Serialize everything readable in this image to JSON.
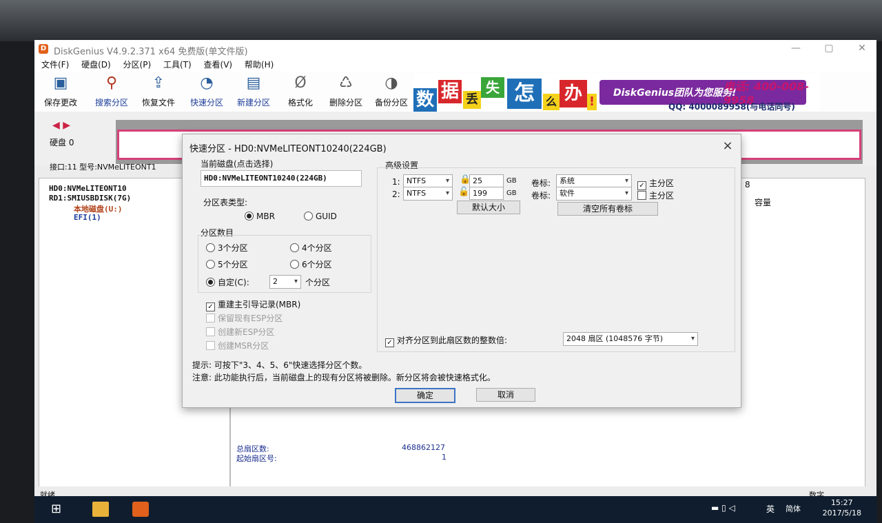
{
  "window": {
    "title": "DiskGenius V4.9.2.371 x64 免费版(单文件版)",
    "min_label": "—",
    "max_label": "▢",
    "close_label": "✕"
  },
  "menu": [
    "文件(F)",
    "硬盘(D)",
    "分区(P)",
    "工具(T)",
    "查看(V)",
    "帮助(H)"
  ],
  "toolbar": [
    "保存更改",
    "搜索分区",
    "恢复文件",
    "快速分区",
    "新建分区",
    "格式化",
    "删除分区",
    "备份分区"
  ],
  "banner": {
    "chars": [
      "数",
      "据",
      "丢",
      "失",
      "怎",
      "么",
      "办"
    ],
    "exclaim": "!",
    "slogan": "DiskGenius团队为您服务!",
    "phone": "电话: 400-008-9958",
    "qq": "QQ: 4000089958(与电话同号)"
  },
  "disk_nav_arrows": "◀ ▶",
  "disk_label": "硬盘 0",
  "disk_info": "接口:11  型号:NVMeLITEONT1",
  "tree": [
    "HD0:NVMeLITEONT10",
    "RD1:SMIUSBDISK(7G)",
    "本地磁盘(U:)",
    "EFI(1)"
  ],
  "right_header": "容量",
  "bg_right_partial": "8",
  "bg_labels": {
    "total_sectors": "总扇区数:",
    "total_sectors_value": "468862127",
    "start_sector": "起始扇区号:",
    "start_sector_value": "1"
  },
  "statusbar": {
    "left": "就绪",
    "right": "数字"
  },
  "taskbar": {
    "ime": "英",
    "ime2": "简体",
    "time": "15:27",
    "date": "2017/5/18"
  },
  "dialog": {
    "title": "快速分区 - HD0:NVMeLITEONT10240(224GB)",
    "close_label": "×",
    "current_disk_label": "当前磁盘(点击选择)",
    "current_disk_value": "HD0:NVMeLITEONT10240(224GB)",
    "table_type_label": "分区表类型:",
    "mbr": "MBR",
    "guid": "GUID",
    "count_label": "分区数目",
    "counts": [
      "3个分区",
      "4个分区",
      "5个分区",
      "6个分区"
    ],
    "custom_label": "自定(C):",
    "custom_value": "2",
    "custom_suffix": "个分区",
    "rebuild_mbr": "重建主引导记录(MBR)",
    "keep_esp": "保留现有ESP分区",
    "create_esp": "创建新ESP分区",
    "create_msr": "创建MSR分区",
    "advanced_label": "高级设置",
    "partitions": [
      {
        "index": "1:",
        "fs": "NTFS",
        "size": "25",
        "unit": "GB",
        "volume_label": "卷标:",
        "volume": "系统",
        "primary": "主分区",
        "primary_checked": true
      },
      {
        "index": "2:",
        "fs": "NTFS",
        "size": "199",
        "unit": "GB",
        "volume_label": "卷标:",
        "volume": "软件",
        "primary": "主分区",
        "primary_checked": false
      }
    ],
    "default_size_btn": "默认大小",
    "clear_labels_btn": "清空所有卷标",
    "align_label": "对齐分区到此扇区数的整数倍:",
    "align_value": "2048 扇区 (1048576 字节)",
    "tip1": "提示: 可按下\"3、4、5、6\"快速选择分区个数。",
    "tip2": "注意: 此功能执行后，当前磁盘上的现有分区将被删除。新分区将会被快速格式化。",
    "ok_btn": "确定",
    "cancel_btn": "取消"
  },
  "colors": {
    "accent": "#3b73c4",
    "disk_border": "#d6407a",
    "banner_purple": "#7a2a9e"
  }
}
